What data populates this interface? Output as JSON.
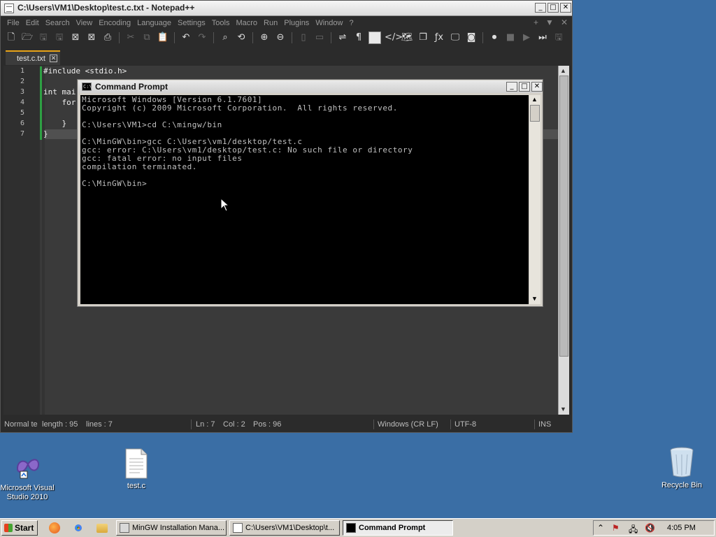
{
  "notepad": {
    "title": "C:\\Users\\VM1\\Desktop\\test.c.txt - Notepad++",
    "menu": [
      "File",
      "Edit",
      "Search",
      "View",
      "Encoding",
      "Language",
      "Settings",
      "Tools",
      "Macro",
      "Run",
      "Plugins",
      "Window",
      "?"
    ],
    "tab": {
      "label": "test.c.txt"
    },
    "line_numbers": [
      "1",
      "2",
      "3",
      "4",
      "5",
      "6",
      "7"
    ],
    "code_lines": [
      "#include <stdio.h>",
      "",
      "int mai",
      "    for",
      "",
      "    }",
      "}"
    ],
    "status": {
      "doc_type": "Normal te",
      "length": "length : 95",
      "lines": "lines : 7",
      "ln": "Ln : 7",
      "col": "Col : 2",
      "pos": "Pos : 96",
      "eol": "Windows (CR LF)",
      "encoding": "UTF-8",
      "mode": "INS"
    }
  },
  "cmd": {
    "title": "Command Prompt",
    "lines": [
      "Microsoft Windows [Version 6.1.7601]",
      "Copyright (c) 2009 Microsoft Corporation.  All rights reserved.",
      "",
      "C:\\Users\\VM1>cd C:\\mingw/bin",
      "",
      "C:\\MinGW\\bin>gcc C:\\Users\\vm1/desktop/test.c",
      "gcc: error: C:\\Users\\vm1/desktop/test.c: No such file or directory",
      "gcc: fatal error: no input files",
      "compilation terminated.",
      "",
      "C:\\MinGW\\bin>"
    ]
  },
  "desktop": {
    "icons": [
      {
        "label": "Microsoft Visual Studio 2010"
      },
      {
        "label": "test.c"
      },
      {
        "label": "Recycle Bin"
      }
    ]
  },
  "taskbar": {
    "start": "Start",
    "tasks": [
      {
        "label": "MinGW Installation Mana..."
      },
      {
        "label": "C:\\Users\\VM1\\Desktop\\t..."
      },
      {
        "label": "Command Prompt"
      }
    ],
    "clock": "4:05 PM"
  },
  "colors": {
    "desktop": "#3a6ea5",
    "editor_bg": "#3a3a3a",
    "tab_accent": "#e8a317",
    "change_marker": "#2ea043",
    "console_text": "#c0c0c0"
  }
}
